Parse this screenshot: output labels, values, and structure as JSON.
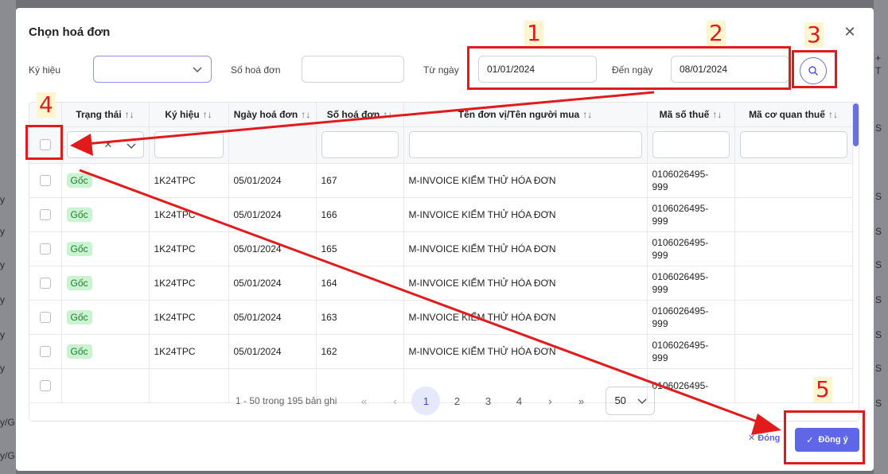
{
  "background": {
    "right_glyphs": [
      "+",
      "T"
    ],
    "left_glyphs": [
      "y",
      "y",
      "y",
      "y",
      "y",
      "y",
      "y/G",
      "y/G"
    ],
    "right_side_glyphs": [
      "S",
      "S",
      "S",
      "S",
      "S",
      "S",
      "S",
      "S"
    ]
  },
  "modal": {
    "title": "Chọn hoá đơn",
    "close_icon": "close-icon"
  },
  "filters": {
    "ky_hieu_label": "Ký hiệu",
    "ky_hieu_value": "",
    "so_hoa_don_label": "Số hoá đơn",
    "so_hoa_don_value": "",
    "tu_ngay_label": "Từ ngày",
    "tu_ngay_value": "01/01/2024",
    "den_ngay_label": "Đến ngày",
    "den_ngay_value": "08/01/2024",
    "search_icon": "search-icon"
  },
  "table": {
    "sort_glyph": "↑↓",
    "columns": [
      {
        "label": "Trạng thái"
      },
      {
        "label": "Ký hiệu"
      },
      {
        "label": "Ngày hoá đơn"
      },
      {
        "label": "Số hoá đơn"
      },
      {
        "label": "Tên đơn vị/Tên người mua"
      },
      {
        "label": "Mã số thuế"
      },
      {
        "label": "Mã cơ quan thuế"
      }
    ],
    "rows": [
      {
        "status": "Gốc",
        "ky_hieu": "1K24TPC",
        "ngay": "05/01/2024",
        "so": "167",
        "ten": "M-INVOICE KIỂM THỬ HÓA ĐƠN",
        "mst_1": "0106026495-",
        "mst_2": "999",
        "ma_cqt": ""
      },
      {
        "status": "Gốc",
        "ky_hieu": "1K24TPC",
        "ngay": "05/01/2024",
        "so": "166",
        "ten": "M-INVOICE KIỂM THỬ HÓA ĐƠN",
        "mst_1": "0106026495-",
        "mst_2": "999",
        "ma_cqt": ""
      },
      {
        "status": "Gốc",
        "ky_hieu": "1K24TPC",
        "ngay": "05/01/2024",
        "so": "165",
        "ten": "M-INVOICE KIỂM THỬ HÓA ĐƠN",
        "mst_1": "0106026495-",
        "mst_2": "999",
        "ma_cqt": ""
      },
      {
        "status": "Gốc",
        "ky_hieu": "1K24TPC",
        "ngay": "05/01/2024",
        "so": "164",
        "ten": "M-INVOICE KIỂM THỬ HÓA ĐƠN",
        "mst_1": "0106026495-",
        "mst_2": "999",
        "ma_cqt": ""
      },
      {
        "status": "Gốc",
        "ky_hieu": "1K24TPC",
        "ngay": "05/01/2024",
        "so": "163",
        "ten": "M-INVOICE KIỂM THỬ HÓA ĐƠN",
        "mst_1": "0106026495-",
        "mst_2": "999",
        "ma_cqt": ""
      },
      {
        "status": "Gốc",
        "ky_hieu": "1K24TPC",
        "ngay": "05/01/2024",
        "so": "162",
        "ten": "M-INVOICE KIỂM THỬ HÓA ĐƠN",
        "mst_1": "0106026495-",
        "mst_2": "999",
        "ma_cqt": ""
      },
      {
        "status": "",
        "ky_hieu": "",
        "ngay": "",
        "so": "",
        "ten": "",
        "mst_1": "0106026495-",
        "mst_2": "",
        "ma_cqt": ""
      }
    ]
  },
  "pagination": {
    "info": "1 - 50 trong 195 bản ghi",
    "first": "«",
    "prev": "‹",
    "pages": [
      "1",
      "2",
      "3",
      "4"
    ],
    "next": "›",
    "last": "»",
    "page_size": "50"
  },
  "footer": {
    "close_label": "Đóng",
    "ok_label": "Đồng ý"
  },
  "annotations": {
    "color": "#e11b1b",
    "labels": [
      "1",
      "2",
      "3",
      "4",
      "5"
    ]
  }
}
